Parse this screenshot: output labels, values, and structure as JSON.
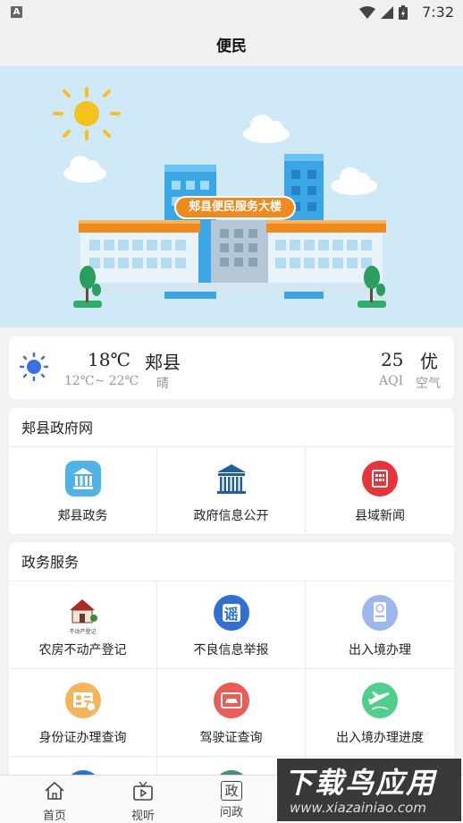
{
  "status_bar": {
    "time": "7:32",
    "app_badge": "A"
  },
  "header": {
    "title": "便民"
  },
  "banner": {
    "sign_text": "郏县便民服务大楼"
  },
  "weather": {
    "temperature": "18℃",
    "range": "12℃~ 22℃",
    "city": "郏县",
    "condition": "晴",
    "aqi_value": "25",
    "aqi_label": "AQI",
    "quality": "优",
    "quality_label": "空气"
  },
  "section1": {
    "title": "郏县政府网",
    "items": [
      {
        "label": "郏县政务",
        "icon": "bank-icon"
      },
      {
        "label": "政府信息公开",
        "icon": "government-building-icon"
      },
      {
        "label": "县域新闻",
        "icon": "news-icon"
      }
    ]
  },
  "section2": {
    "title": "政务服务",
    "items": [
      {
        "label": "农房不动产登记",
        "icon": "house-registration-icon",
        "logo_text": "不动产登记"
      },
      {
        "label": "不良信息举报",
        "icon": "report-icon",
        "glyph": "谣"
      },
      {
        "label": "出入境办理",
        "icon": "passport-icon"
      },
      {
        "label": "身份证办理查询",
        "icon": "id-card-icon"
      },
      {
        "label": "驾驶证查询",
        "icon": "driver-license-icon"
      },
      {
        "label": "出入境办理进度",
        "icon": "plane-icon"
      }
    ]
  },
  "bottom_nav": {
    "items": [
      {
        "label": "首页",
        "icon": "home-icon"
      },
      {
        "label": "视听",
        "icon": "tv-icon"
      },
      {
        "label": "问政",
        "icon": "politics-icon",
        "glyph": "政"
      }
    ]
  },
  "watermark": {
    "text": "下载鸟应用",
    "url": "www.xiazainiao.com"
  },
  "colors": {
    "background": "#f2f2f2",
    "banner_sky": "#cfeaf6",
    "sign_orange": "#f08a1c",
    "news_red": "#e8333a",
    "report_blue": "#2f6fd6"
  }
}
